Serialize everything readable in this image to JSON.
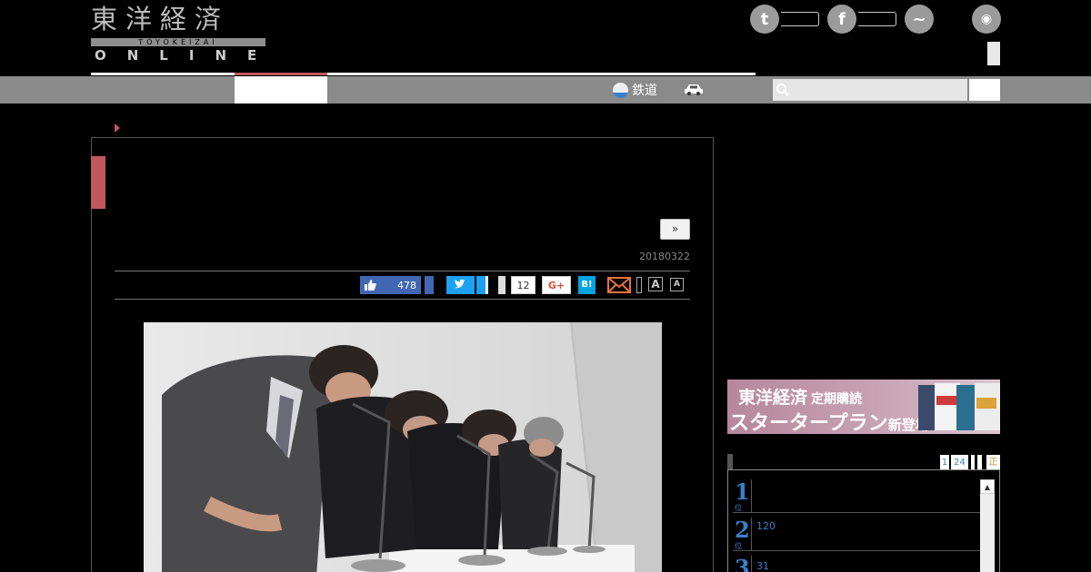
{
  "header": {
    "logo_text": "東洋経済",
    "logo_sub": "TOYOKEIZAI",
    "logo_online": "ONLINE"
  },
  "social": {
    "twitter_glyph": "t",
    "facebook_glyph": "f",
    "messenger_glyph": "~",
    "rss_glyph": "◉"
  },
  "nav": {
    "railway_label": "鉄道",
    "search": {
      "placeholder": ""
    }
  },
  "article": {
    "next_label": "»",
    "date": "20180322",
    "share": {
      "like_count": "478",
      "pocket_count": "12",
      "gplus_label": "G+",
      "hatena_label": "B!"
    },
    "font_large_label": "A",
    "font_small_label": "A"
  },
  "ad": {
    "line1_main": "東洋経済",
    "line1_sub": "定期購読",
    "line2_main": "スタータープラン",
    "line2_new": "新登場!"
  },
  "ranking": {
    "tabs": [
      "1",
      "24",
      "",
      "",
      "正"
    ],
    "items": [
      {
        "rank": "1",
        "unit": "位",
        "text": ""
      },
      {
        "rank": "2",
        "unit": "位",
        "text": "120"
      },
      {
        "rank": "3",
        "unit": "位",
        "text": "31"
      }
    ],
    "scroll_up": "▲"
  },
  "colors": {
    "accent": "#c0585c",
    "nav_gray": "#8a8a8a",
    "facebook": "#4267b2",
    "twitter": "#1da1f2",
    "hatena": "#00a4de",
    "link_blue": "#3a7fc9"
  }
}
